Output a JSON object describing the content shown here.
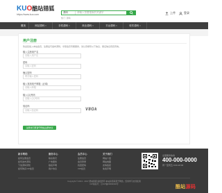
{
  "header": {
    "logo_prefix_1": "KU",
    "logo_o": "O",
    "logo_cn": "酷站猎狐",
    "logo_url": "https://www.kuo.com",
    "search_category": "源码",
    "search_placeholder": "请输入您要搜索的关键字",
    "hot_words": "热门: 源码",
    "upload_label": "上传",
    "login_label": "登录"
  },
  "nav": {
    "home": "首页",
    "items": [
      "网站源码",
      "手机源码",
      "商业源码",
      "平台源码",
      "软件源码"
    ]
  },
  "form": {
    "title": "用户注册",
    "intro": "欢迎您加入本站会员，注册后可发布源码、享受会员专属服务，请认真填写以下信息，保证信息真实有效。",
    "fields": [
      {
        "label": "输入注册用户名",
        "placeholder": "请输入用户名"
      },
      {
        "label": "密码",
        "placeholder": "请输入密码"
      },
      {
        "label": "确认密码",
        "placeholder": "再次输入密码"
      },
      {
        "label": "输入常用电子邮箱（必填）",
        "placeholder": "请输入邮箱"
      },
      {
        "label": "输入QQ号码",
        "placeholder": "请输入QQ号码"
      },
      {
        "label": "验证码",
        "placeholder": "请输入验证码"
      }
    ],
    "captcha_text": "V8Gk",
    "submit_label": "注册并同意遵守网站注册协议"
  },
  "footer": {
    "cols": [
      {
        "title": "新手帮助",
        "items": [
          "如何注册会员",
          "如何发布源码",
          "下载源码须知",
          "如何购买VIP会员"
        ]
      },
      {
        "title": "服务中心",
        "items": [
          "联系我们",
          "广告服务",
          "版权声明",
          "用户协议"
        ]
      },
      {
        "title": "会员中心",
        "items": [
          "注册会员",
          "会员登录",
          "找回密码",
          "VIP会员"
        ]
      },
      {
        "title": "关于我们",
        "items": [
          "网站介绍",
          "网站地图",
          "友情链接",
          "免责声明"
        ]
      }
    ],
    "hotline_label": "全国服务热线",
    "phone": "400-000-0000",
    "hours": "周一至周五 9:00-18:00",
    "copyright": "Copyright © 2013 - 2017 酷站猎狐 版权所有 本站资源来源于网络，仅供学习交流使用",
    "icp": "ICP备案号：京ICP备00000000号"
  },
  "watermark": {
    "a": "酷站",
    "b": "源码"
  },
  "colors": {
    "accent": "#37a84a",
    "nav_bg": "#3f3f3f",
    "footer_bg": "#3a3a3a"
  }
}
